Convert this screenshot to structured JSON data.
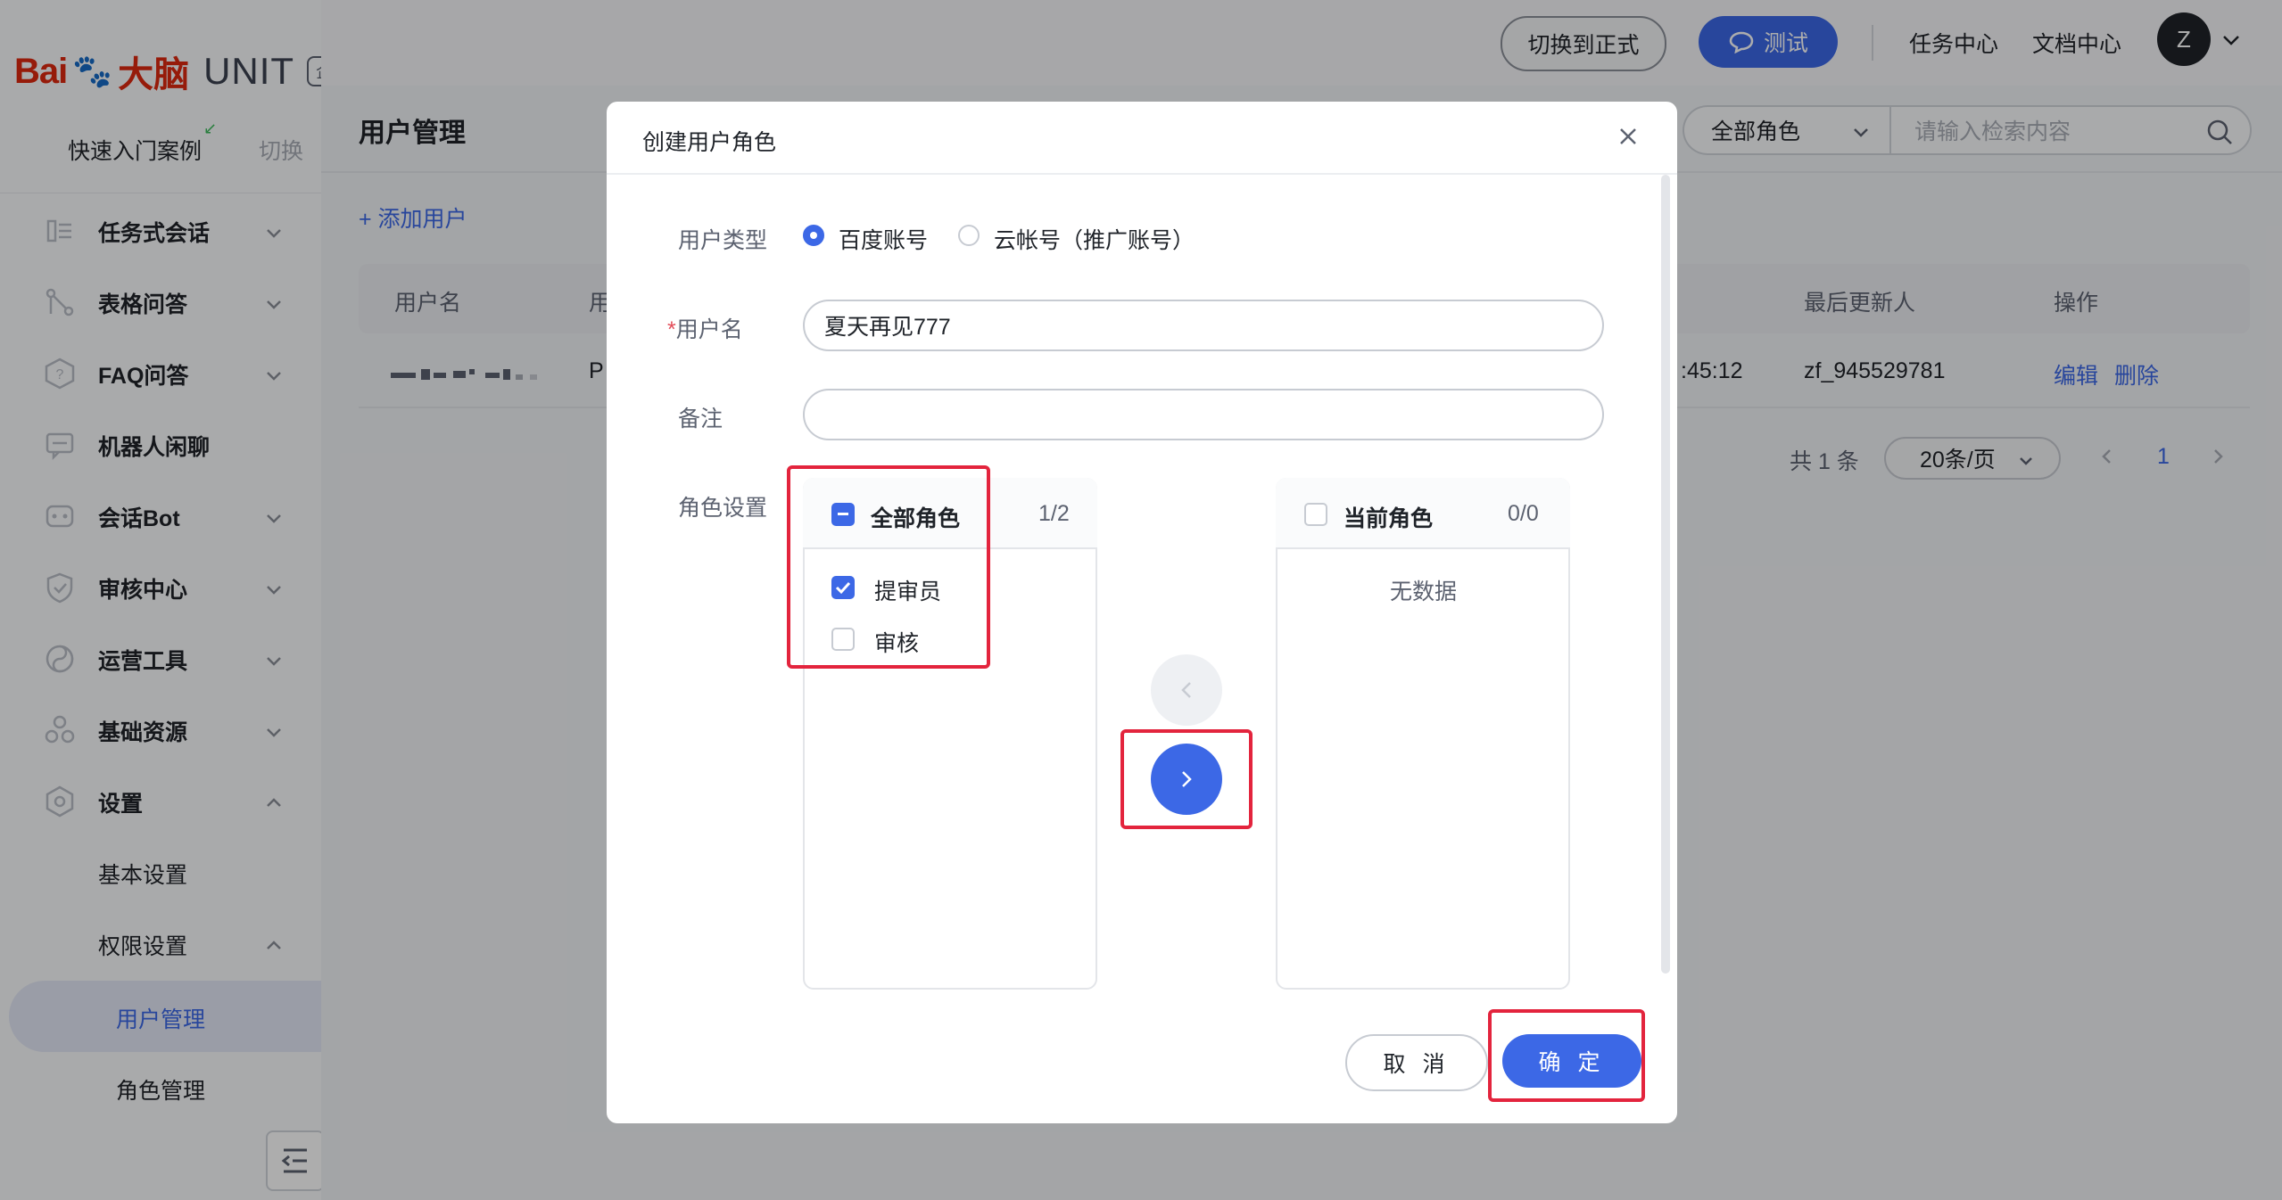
{
  "sidebar": {
    "logo": {
      "bai": "Bai",
      "paw": "🐾",
      "du": "大脑",
      "unit": "UNIT",
      "edition": "企业版"
    },
    "quick_start": "快速入门案例",
    "switch": "切换",
    "menu": [
      {
        "label": "任务式会话",
        "icon": "task-dialog-icon"
      },
      {
        "label": "表格问答",
        "icon": "table-qa-icon"
      },
      {
        "label": "FAQ问答",
        "icon": "faq-icon"
      },
      {
        "label": "机器人闲聊",
        "icon": "chat-icon"
      },
      {
        "label": "会话Bot",
        "icon": "bot-icon"
      },
      {
        "label": "审核中心",
        "icon": "shield-icon"
      },
      {
        "label": "运营工具",
        "icon": "tools-icon"
      },
      {
        "label": "基础资源",
        "icon": "resource-icon"
      },
      {
        "label": "设置",
        "icon": "gear-icon"
      }
    ],
    "settings_children": {
      "basic": "基本设置",
      "permission": "权限设置",
      "user_mgmt": "用户管理",
      "role_mgmt": "角色管理"
    }
  },
  "header": {
    "switch_formal": "切换到正式",
    "test": "测试",
    "task_center": "任务中心",
    "doc_center": "文档中心",
    "avatar_letter": "Z"
  },
  "page": {
    "title": "用户管理",
    "add_user": "添加用户",
    "filter_select": "全部角色",
    "search_placeholder": "请输入检索内容",
    "table": {
      "headers": {
        "username": "用户名",
        "col2": "用",
        "updater": "最后更新人",
        "ops": "操作"
      },
      "row": {
        "col2": "P",
        "time": ":45:12",
        "updater": "zf_945529781",
        "edit": "编辑",
        "delete": "删除"
      }
    },
    "pager": {
      "total": "共 1 条",
      "size": "20条/页",
      "page": "1"
    }
  },
  "modal": {
    "title": "创建用户角色",
    "user_type_label": "用户类型",
    "user_type_options": [
      "百度账号",
      "云帐号（推广账号）"
    ],
    "user_type_selected": 0,
    "username_label": "用户名",
    "username_value": "夏天再见777",
    "remark_label": "备注",
    "remark_value": "",
    "role_label": "角色设置",
    "left_panel": {
      "title": "全部角色",
      "count": "1/2",
      "items": [
        {
          "label": "提审员",
          "checked": true
        },
        {
          "label": "审核",
          "checked": false
        }
      ]
    },
    "right_panel": {
      "title": "当前角色",
      "count": "0/0",
      "empty": "无数据"
    },
    "cancel": "取 消",
    "confirm": "确 定"
  },
  "colors": {
    "primary": "#3c68e6",
    "highlight": "#e3243d",
    "logo_red": "#de2910"
  }
}
